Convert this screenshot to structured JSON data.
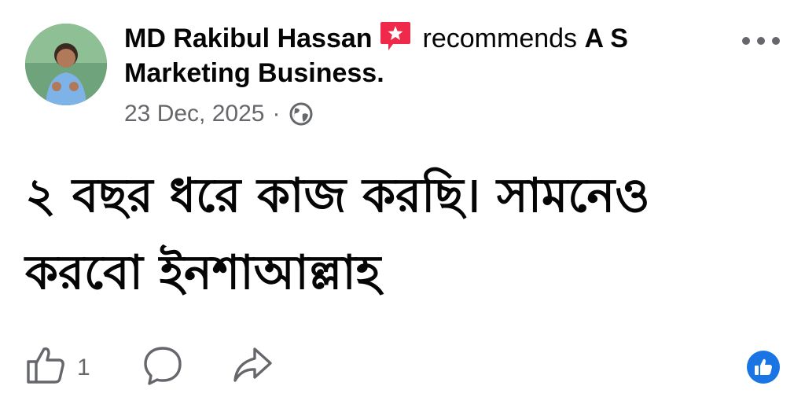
{
  "header": {
    "author": "MD Rakibul Hassan",
    "recommends_word": "recommends",
    "page_name": "A S Marketing Business.",
    "date": "23 Dec, 2025",
    "separator": "·",
    "privacy_icon": "globe-icon",
    "more_icon": "more-options-icon"
  },
  "post": {
    "text_line1": "২ বছর ধরে কাজ করছি। সামনেও",
    "text_line2": "করবো ইনশাআল্লাহ"
  },
  "actions": {
    "like_icon": "thumbs-up-icon",
    "like_count": "1",
    "comment_icon": "comment-icon",
    "share_icon": "share-icon",
    "reaction_icon": "like-reaction-icon"
  },
  "colors": {
    "text_primary": "#050505",
    "text_secondary": "#65676b",
    "recommend_red": "#f0284a",
    "like_blue": "#1b74e4"
  }
}
